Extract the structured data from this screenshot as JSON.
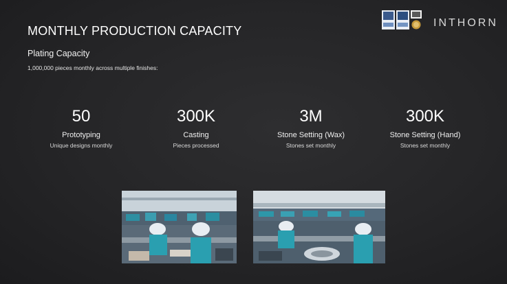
{
  "header": {
    "title": "MONTHLY PRODUCTION CAPACITY",
    "subtitle": "Plating Capacity",
    "description": "1,000,000 pieces monthly across multiple finishes:",
    "brand": "INTHORN"
  },
  "logos": [
    "certification-logo",
    "certification-logo",
    "certification-logo",
    "seal-logo"
  ],
  "stats": [
    {
      "value": "50",
      "label": "Prototyping",
      "sub": "Unique designs monthly"
    },
    {
      "value": "300K",
      "label": "Casting",
      "sub": "Pieces processed"
    },
    {
      "value": "3M",
      "label": "Stone Setting (Wax)",
      "sub": "Stones set monthly"
    },
    {
      "value": "300K",
      "label": "Stone Setting (Hand)",
      "sub": "Stones set monthly"
    }
  ],
  "photos": [
    "factory-workers-photo",
    "factory-floor-photo"
  ],
  "colors": {
    "background": "#252527",
    "text": "#ffffff",
    "teal_uniform": "#2a9fb0",
    "hairnet": "#e8edf2"
  }
}
